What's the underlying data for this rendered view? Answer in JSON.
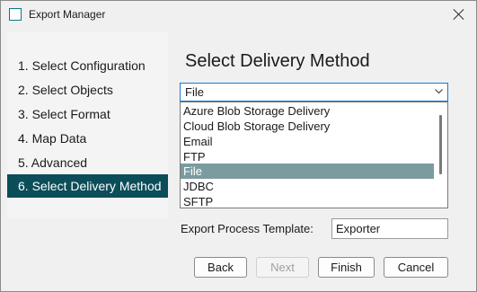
{
  "window": {
    "title": "Export Manager",
    "accent": "#0b4d59"
  },
  "steps": [
    {
      "label": "1. Select Configuration",
      "active": false
    },
    {
      "label": "2. Select Objects",
      "active": false
    },
    {
      "label": "3. Select Format",
      "active": false
    },
    {
      "label": "4. Map Data",
      "active": false
    },
    {
      "label": "5. Advanced",
      "active": false
    },
    {
      "label": "6. Select Delivery Method",
      "active": true
    }
  ],
  "main": {
    "title": "Select Delivery Method",
    "delivery": {
      "selected": "File",
      "options": [
        "Azure Blob Storage Delivery",
        "Cloud Blob Storage Delivery",
        "Email",
        "FTP",
        "File",
        "JDBC",
        "SFTP"
      ]
    },
    "template": {
      "label": "Export Process Template:",
      "value": "Exporter"
    }
  },
  "buttons": {
    "back": "Back",
    "next": "Next",
    "finish": "Finish",
    "cancel": "Cancel"
  }
}
